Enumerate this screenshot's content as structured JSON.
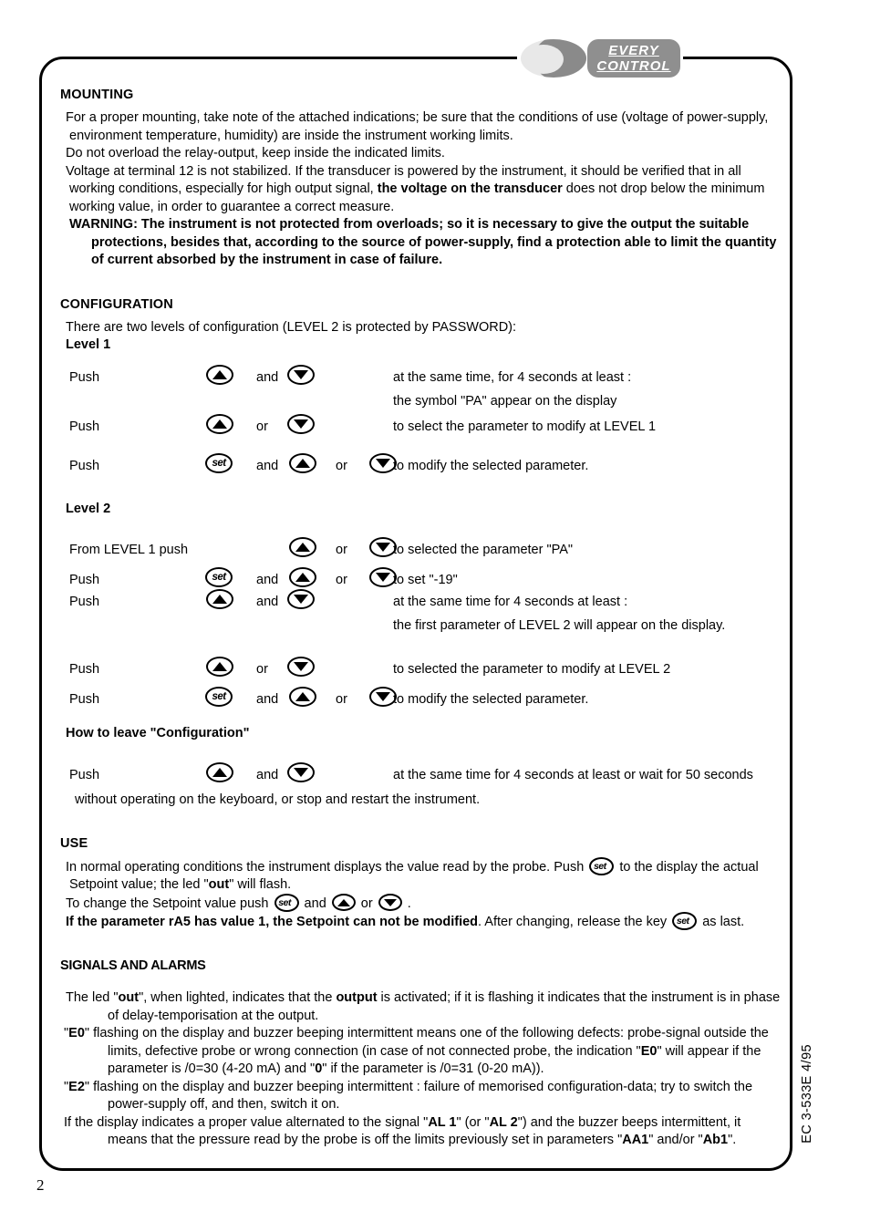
{
  "logo": {
    "mark_name": "every-control-logo-mark",
    "line1": "EVERY",
    "line2": "CONTROL",
    "mark_color_light": "#e8e8e8",
    "mark_color_dark": "#8a8a8a",
    "box_color": "#8f8f8f"
  },
  "mounting": {
    "heading": "MOUNTING",
    "p1_a": "For a proper mounting, take note of the attached indications; be sure that the conditions of use (voltage of power-supply, environment temperature, humidity) are inside the instrument working limits.",
    "p2": "Do not overload the relay-output, keep inside the indicated limits.",
    "p3_a": "Voltage at terminal 12 is not stabilized. If the transducer is powered by the instrument, it should be verified that in all working conditions, especially for high output signal, ",
    "p3_b": "the voltage on the transducer",
    "p3_c": " does not drop below the minimum working value, in order to guarantee a correct measure.",
    "warning": "WARNING: The  instrument is not protected from overloads; so it is necessary to give the output the suitable protections, besides that, according to the source of power-supply, find a protection able to limit the quantity of current absorbed by the instrument in case of failure."
  },
  "configuration": {
    "heading": "CONFIGURATION",
    "intro": "There are two levels  of configuration (LEVEL 2 is protected by PASSWORD):",
    "level1_label": "Level 1",
    "level2_label": "Level 2",
    "leave_label": "How to leave \"Configuration\"",
    "level1_rows": [
      {
        "push": "Push",
        "key1": "up",
        "conj1": "and",
        "key2": "down",
        "conj2": "",
        "key3": "",
        "desc": "at the same time, for 4 seconds at least :",
        "desc2": "the symbol \"PA\" appear on the display"
      },
      {
        "push": "Push",
        "key1": "up",
        "conj1": "or",
        "key2": "down",
        "conj2": "",
        "key3": "",
        "desc": "to select the parameter to modify at LEVEL 1",
        "desc2": ""
      },
      {
        "push": "Push",
        "key1": "set",
        "conj1": "and",
        "key2": "up",
        "conj2": "or",
        "key3": "down",
        "desc": "to modify the selected parameter.",
        "desc2": ""
      }
    ],
    "level2_rows": [
      {
        "push": "From LEVEL 1 push",
        "key1": "",
        "conj1": "",
        "key2": "up",
        "conj2": "or",
        "key3": "down",
        "desc": "to selected the parameter \"PA\"",
        "desc2": ""
      },
      {
        "push": "Push",
        "key1": "set",
        "conj1": "and",
        "key2": "up",
        "conj2": "or",
        "key3": "down",
        "desc": "to set \"-19\"",
        "desc2": ""
      },
      {
        "push": "Push",
        "key1": "up",
        "conj1": "and",
        "key2": "down",
        "conj2": "",
        "key3": "",
        "desc": "at the same time for 4 seconds at least :",
        "desc2": "the first parameter of LEVEL 2 will appear on the display."
      },
      {
        "push": "Push",
        "key1": "up",
        "conj1": "or",
        "key2": "down",
        "conj2": "",
        "key3": "",
        "desc": "to selected the parameter to modify at LEVEL 2",
        "desc2": ""
      },
      {
        "push": "Push",
        "key1": "set",
        "conj1": "and",
        "key2": "up",
        "conj2": "or",
        "key3": "down",
        "desc": "to modify the selected parameter.",
        "desc2": ""
      }
    ],
    "leave_row": {
      "push": "Push",
      "key1": "up",
      "conj1": "and",
      "key2": "down",
      "desc": "at the same time for 4 seconds at least or wait  for 50 seconds"
    },
    "leave_cont": "without operating on the keyboard, or stop and restart the instrument."
  },
  "use": {
    "heading": "USE",
    "p1_a": "In normal operating conditions the instrument displays the value read by the probe. Push ",
    "p1_b": " to the display the actual Setpoint value; the led \"",
    "p1_bold": "out",
    "p1_c": "\" will flash.",
    "p2_a": "To change the Setpoint value push ",
    "p2_b": " and ",
    "p2_c": " or ",
    "p2_d": " .",
    "p3_bold": "If the parameter rA5 has value 1, the Setpoint can not be modified",
    "p3_a": ". After changing, release the key ",
    "p3_b": " as last."
  },
  "signals": {
    "heading": "SIGNALS AND ALARMS",
    "led_a": "The led  \"",
    "led_bold1": "out",
    "led_b": "\", when lighted, indicates that the ",
    "led_bold2": "output",
    "led_c": " is activated; if it is flashing it indicates that the instrument is in phase of  delay-temporisation at the output.",
    "e0_q1": "\"",
    "e0_bold1": "E0",
    "e0_a": "\" flashing on the display and buzzer beeping intermittent means  one of the following defects:  probe-signal outside the limits, defective probe or wrong connection (in case of not connected probe, the indication \"",
    "e0_bold2": "E0",
    "e0_b": "\" will appear if the parameter is /0=30 (4-20 mA) and \"",
    "e0_bold3": "0",
    "e0_c": "\" if the parameter is /0=31 (0-20 mA)).",
    "e2_q1": "\"",
    "e2_bold1": "E2",
    "e2_a": "\" flashing on the display and buzzer beeping intermittent : failure of memorised configuration-data; try to switch the power-supply off, and then, switch it on.",
    "al_a": "If the display  indicates a proper value alternated to the signal \"",
    "al_bold1": "AL 1",
    "al_b": "\" (or \"",
    "al_bold2": "AL 2",
    "al_c": "\") and the buzzer beeps intermittent, it means that the pressure read by the probe is off the limits previously set in parameters \"",
    "al_bold3": "AA1",
    "al_d": "\" and/or  \"",
    "al_bold4": "Ab1",
    "al_e": "\"."
  },
  "footer": {
    "side_code": "EC 3-533E 4/95",
    "page_number": "2"
  }
}
